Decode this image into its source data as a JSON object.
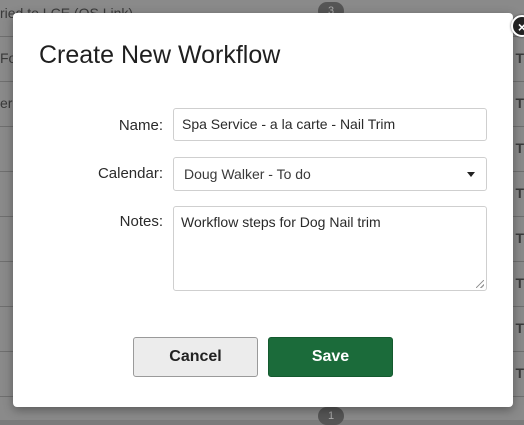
{
  "background": {
    "rows": [
      {
        "left": "ried to LCE (OS Link)",
        "right": ""
      },
      {
        "left": "Fo",
        "right": "T"
      },
      {
        "left": "er",
        "right": "T"
      },
      {
        "left": "",
        "right": "T"
      },
      {
        "left": "",
        "right": "T"
      },
      {
        "left": "",
        "right": "T"
      },
      {
        "left": "",
        "right": "T"
      },
      {
        "left": "",
        "right": "T"
      },
      {
        "left": "",
        "right": "T"
      }
    ],
    "badge_top": "3",
    "badge_bottom": "1"
  },
  "modal": {
    "title": "Create New Workflow",
    "close_symbol": "×",
    "fields": {
      "name_label": "Name:",
      "name_value": "Spa Service - a la carte - Nail Trim",
      "calendar_label": "Calendar:",
      "calendar_value": "Doug Walker - To do",
      "notes_label": "Notes:",
      "notes_value": "Workflow steps for Dog Nail trim"
    },
    "buttons": {
      "cancel": "Cancel",
      "save": "Save"
    }
  },
  "colors": {
    "save_button": "#1b6b3a",
    "overlay": "#8a8a8a"
  }
}
